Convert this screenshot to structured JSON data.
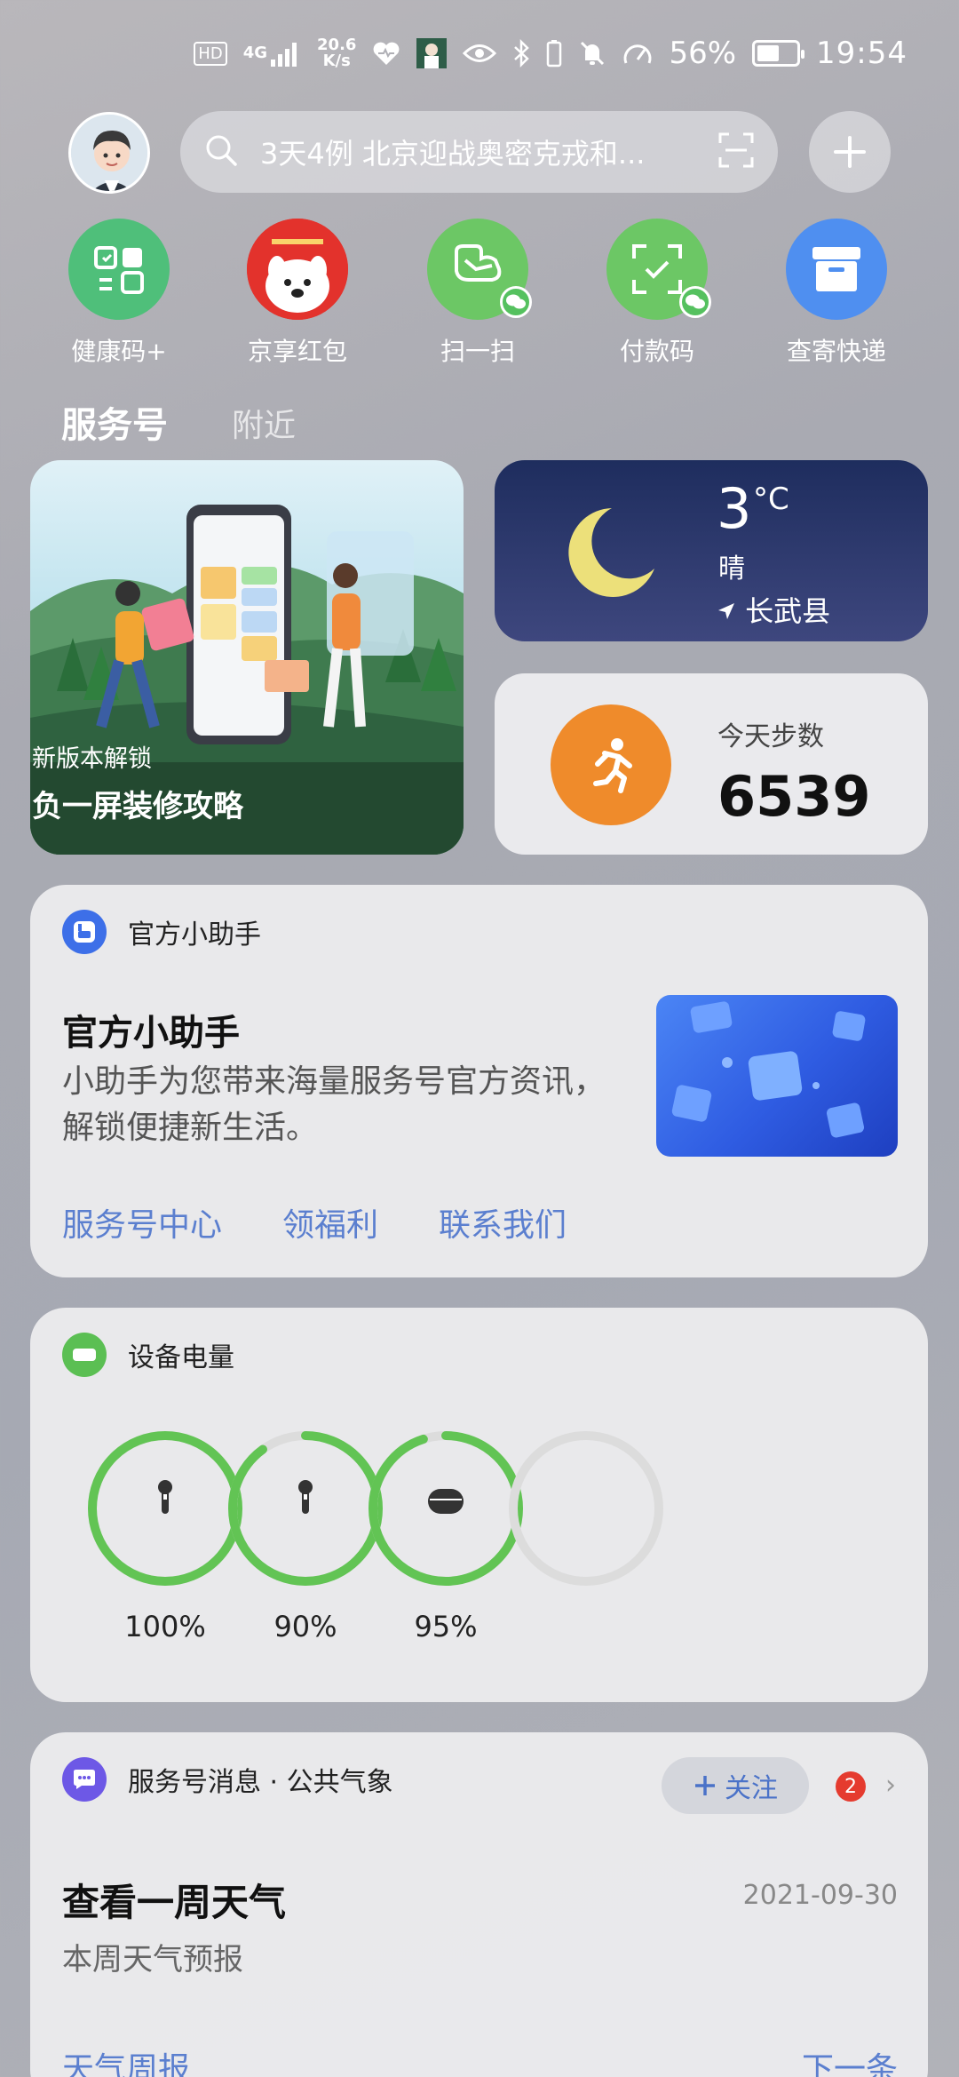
{
  "status_bar": {
    "hd": "HD",
    "network": "4G",
    "speed_value": "20.6",
    "speed_unit": "K/s",
    "battery_pct": "56%",
    "battery_level": 0.56,
    "time": "19:54"
  },
  "search": {
    "placeholder": "3天4例 北京迎战奥密克戎和..."
  },
  "quick_actions": [
    {
      "label": "健康码+",
      "icon": "health-code-icon",
      "color": "#4fbf7a"
    },
    {
      "label": "京享红包",
      "icon": "jd-red-packet-icon",
      "color": "#e3322c"
    },
    {
      "label": "扫一扫",
      "icon": "scan-icon",
      "color": "#6cc765"
    },
    {
      "label": "付款码",
      "icon": "pay-code-icon",
      "color": "#6cc765"
    },
    {
      "label": "查寄快递",
      "icon": "express-box-icon",
      "color": "#4f8ff0"
    }
  ],
  "tabs": {
    "active": "服务号",
    "inactive": "附近"
  },
  "promo_card": {
    "subtitle": "新版本解锁",
    "title": "负一屏装修攻略"
  },
  "weather": {
    "temp": "3",
    "unit": "°C",
    "condition": "晴",
    "location": "长武县"
  },
  "steps": {
    "label": "今天步数",
    "value": "6539"
  },
  "assistant": {
    "header": "官方小助手",
    "title": "官方小助手",
    "description": "小助手为您带来海量服务号官方资讯，解锁便捷新生活。",
    "links": [
      "服务号中心",
      "领福利",
      "联系我们"
    ]
  },
  "device_battery": {
    "header": "设备电量",
    "devices": [
      {
        "icon": "earbud-left-icon",
        "percent": "100%",
        "level": 1.0
      },
      {
        "icon": "earbud-right-icon",
        "percent": "90%",
        "level": 0.9
      },
      {
        "icon": "earbud-case-icon",
        "percent": "95%",
        "level": 0.95
      },
      {
        "icon": "empty-slot",
        "percent": "",
        "level": 0
      }
    ],
    "ring_color": "#62c454",
    "ring_track": "#dcdcdc"
  },
  "service_message": {
    "header": "服务号消息 · 公共气象",
    "follow": "关注",
    "badge": "2",
    "title": "查看一周天气",
    "date": "2021-09-30",
    "subtitle": "本周天气预报",
    "link_left": "天气周报",
    "link_right": "下一条"
  }
}
